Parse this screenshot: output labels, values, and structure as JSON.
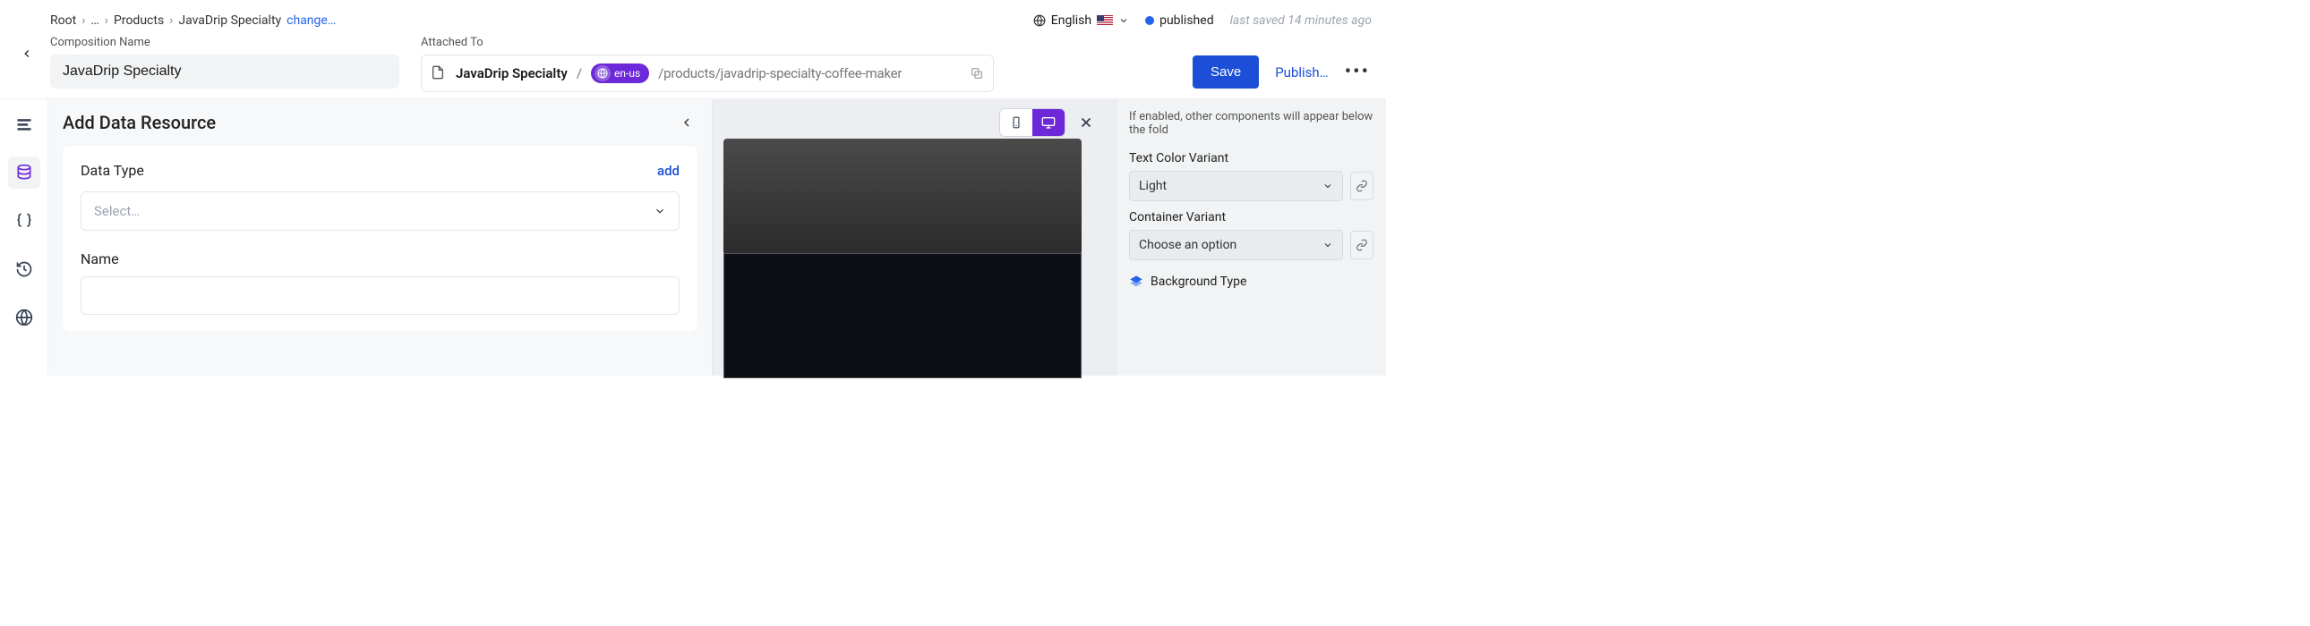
{
  "breadcrumb": {
    "root": "Root",
    "ellipsis": "…",
    "products": "Products",
    "current": "JavaDrip Specialty",
    "change": "change…"
  },
  "header": {
    "composition_label": "Composition Name",
    "composition_value": "JavaDrip Specialty",
    "attached_label": "Attached To",
    "attached_name": "JavaDrip Specialty",
    "locale": "en-us",
    "attached_path": "/products/javadrip-specialty-coffee-maker"
  },
  "topright": {
    "lang": "English",
    "status": "published",
    "saved": "last saved 14 minutes ago"
  },
  "actions": {
    "save": "Save",
    "publish": "Publish…"
  },
  "panel": {
    "title": "Add Data Resource",
    "data_type_label": "Data Type",
    "add": "add",
    "select_placeholder": "Select…",
    "name_label": "Name"
  },
  "inspector": {
    "hint": "If enabled, other components will appear below the fold",
    "text_color_label": "Text Color Variant",
    "text_color_value": "Light",
    "container_label": "Container Variant",
    "container_value": "Choose an option",
    "bg_type_label": "Background Type"
  }
}
